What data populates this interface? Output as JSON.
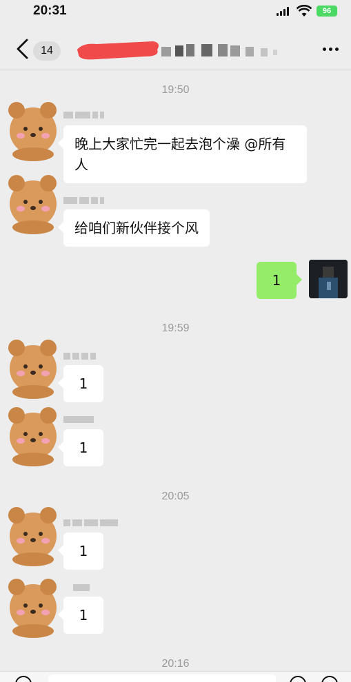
{
  "status_bar": {
    "time": "20:31",
    "battery": "96",
    "icons": [
      "signal-icon",
      "wifi-icon",
      "battery-icon"
    ]
  },
  "header": {
    "unread_count": "14",
    "title": "",
    "back_icon": "chevron-left-icon",
    "more_icon": "more-dots-icon"
  },
  "messages": [
    {
      "type": "time",
      "text": "19:50"
    },
    {
      "type": "incoming",
      "sender": "",
      "text": "晚上大家忙完一起去泡个澡 @所有人"
    },
    {
      "type": "incoming",
      "sender": "",
      "text": "给咱们新伙伴接个风"
    },
    {
      "type": "outgoing",
      "text": "1"
    },
    {
      "type": "time",
      "text": "19:59"
    },
    {
      "type": "incoming",
      "sender": "",
      "text": "1"
    },
    {
      "type": "incoming",
      "sender": "",
      "text": "1"
    },
    {
      "type": "time",
      "text": "20:05"
    },
    {
      "type": "incoming",
      "sender": "",
      "text": "1"
    },
    {
      "type": "incoming",
      "sender": "",
      "text": "1"
    },
    {
      "type": "time",
      "text": "20:16"
    }
  ],
  "colors": {
    "background": "#ededed",
    "outgoing_bubble": "#95ec69",
    "incoming_bubble": "#ffffff",
    "timestamp": "#9a9a9a",
    "battery": "#4cd964"
  }
}
